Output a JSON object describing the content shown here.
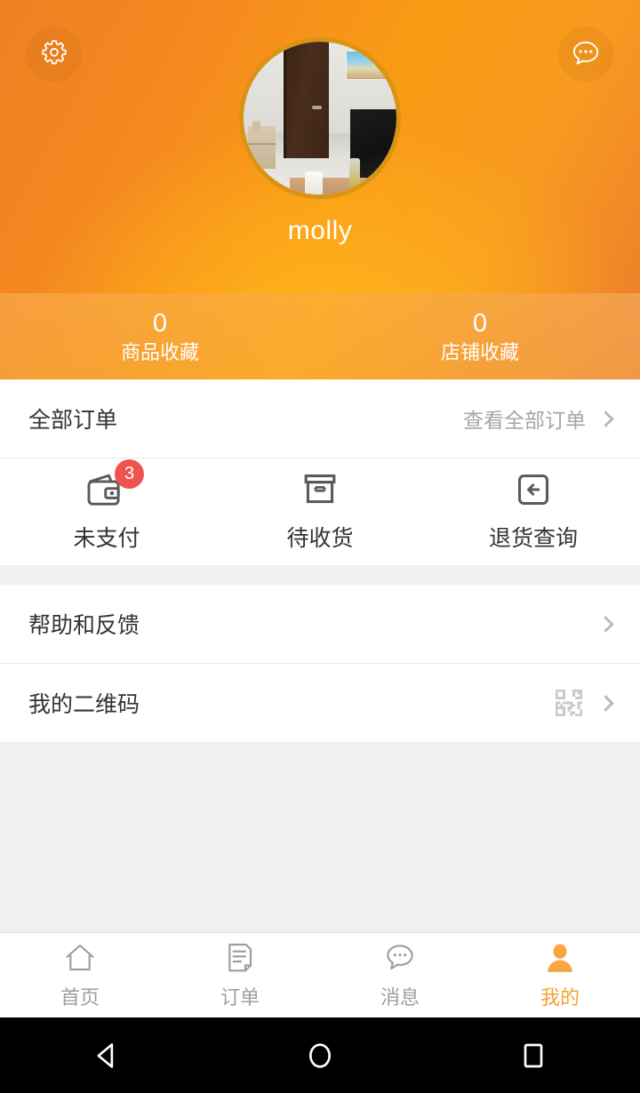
{
  "header": {
    "settings_icon": "gear-icon",
    "message_icon": "chat-bubble-dots-icon",
    "avatar_alt": "user-avatar-room-photo",
    "username": "molly",
    "colors": {
      "gradient_from": "#f07f23",
      "gradient_to": "#ffb41e",
      "avatar_ring": "#d99414"
    }
  },
  "stats": [
    {
      "value": "0",
      "label": "商品收藏"
    },
    {
      "value": "0",
      "label": "店铺收藏"
    }
  ],
  "orders": {
    "title": "全部订单",
    "view_all": "查看全部订单",
    "chevron_icon": "chevron-right-icon",
    "tiles": [
      {
        "label": "未支付",
        "icon": "wallet-icon",
        "badge": "3"
      },
      {
        "label": "待收货",
        "icon": "package-box-icon",
        "badge": ""
      },
      {
        "label": "退货查询",
        "icon": "return-arrow-icon",
        "badge": ""
      }
    ]
  },
  "menu": [
    {
      "label": "帮助和反馈",
      "icon": "",
      "chevron_icon": "chevron-right-icon"
    },
    {
      "label": "我的二维码",
      "icon": "qr-code-icon",
      "chevron_icon": "chevron-right-icon"
    }
  ],
  "tabbar": {
    "active_color": "#f7a033",
    "inactive_color": "#9e9e9e",
    "items": [
      {
        "label": "首页",
        "icon": "home-icon",
        "active": false
      },
      {
        "label": "订单",
        "icon": "document-list-icon",
        "active": false
      },
      {
        "label": "消息",
        "icon": "chat-bubble-icon",
        "active": false
      },
      {
        "label": "我的",
        "icon": "person-icon",
        "active": true
      }
    ]
  },
  "sysnav": {
    "back": "back-triangle-icon",
    "home": "home-circle-icon",
    "recents": "recents-square-icon"
  }
}
